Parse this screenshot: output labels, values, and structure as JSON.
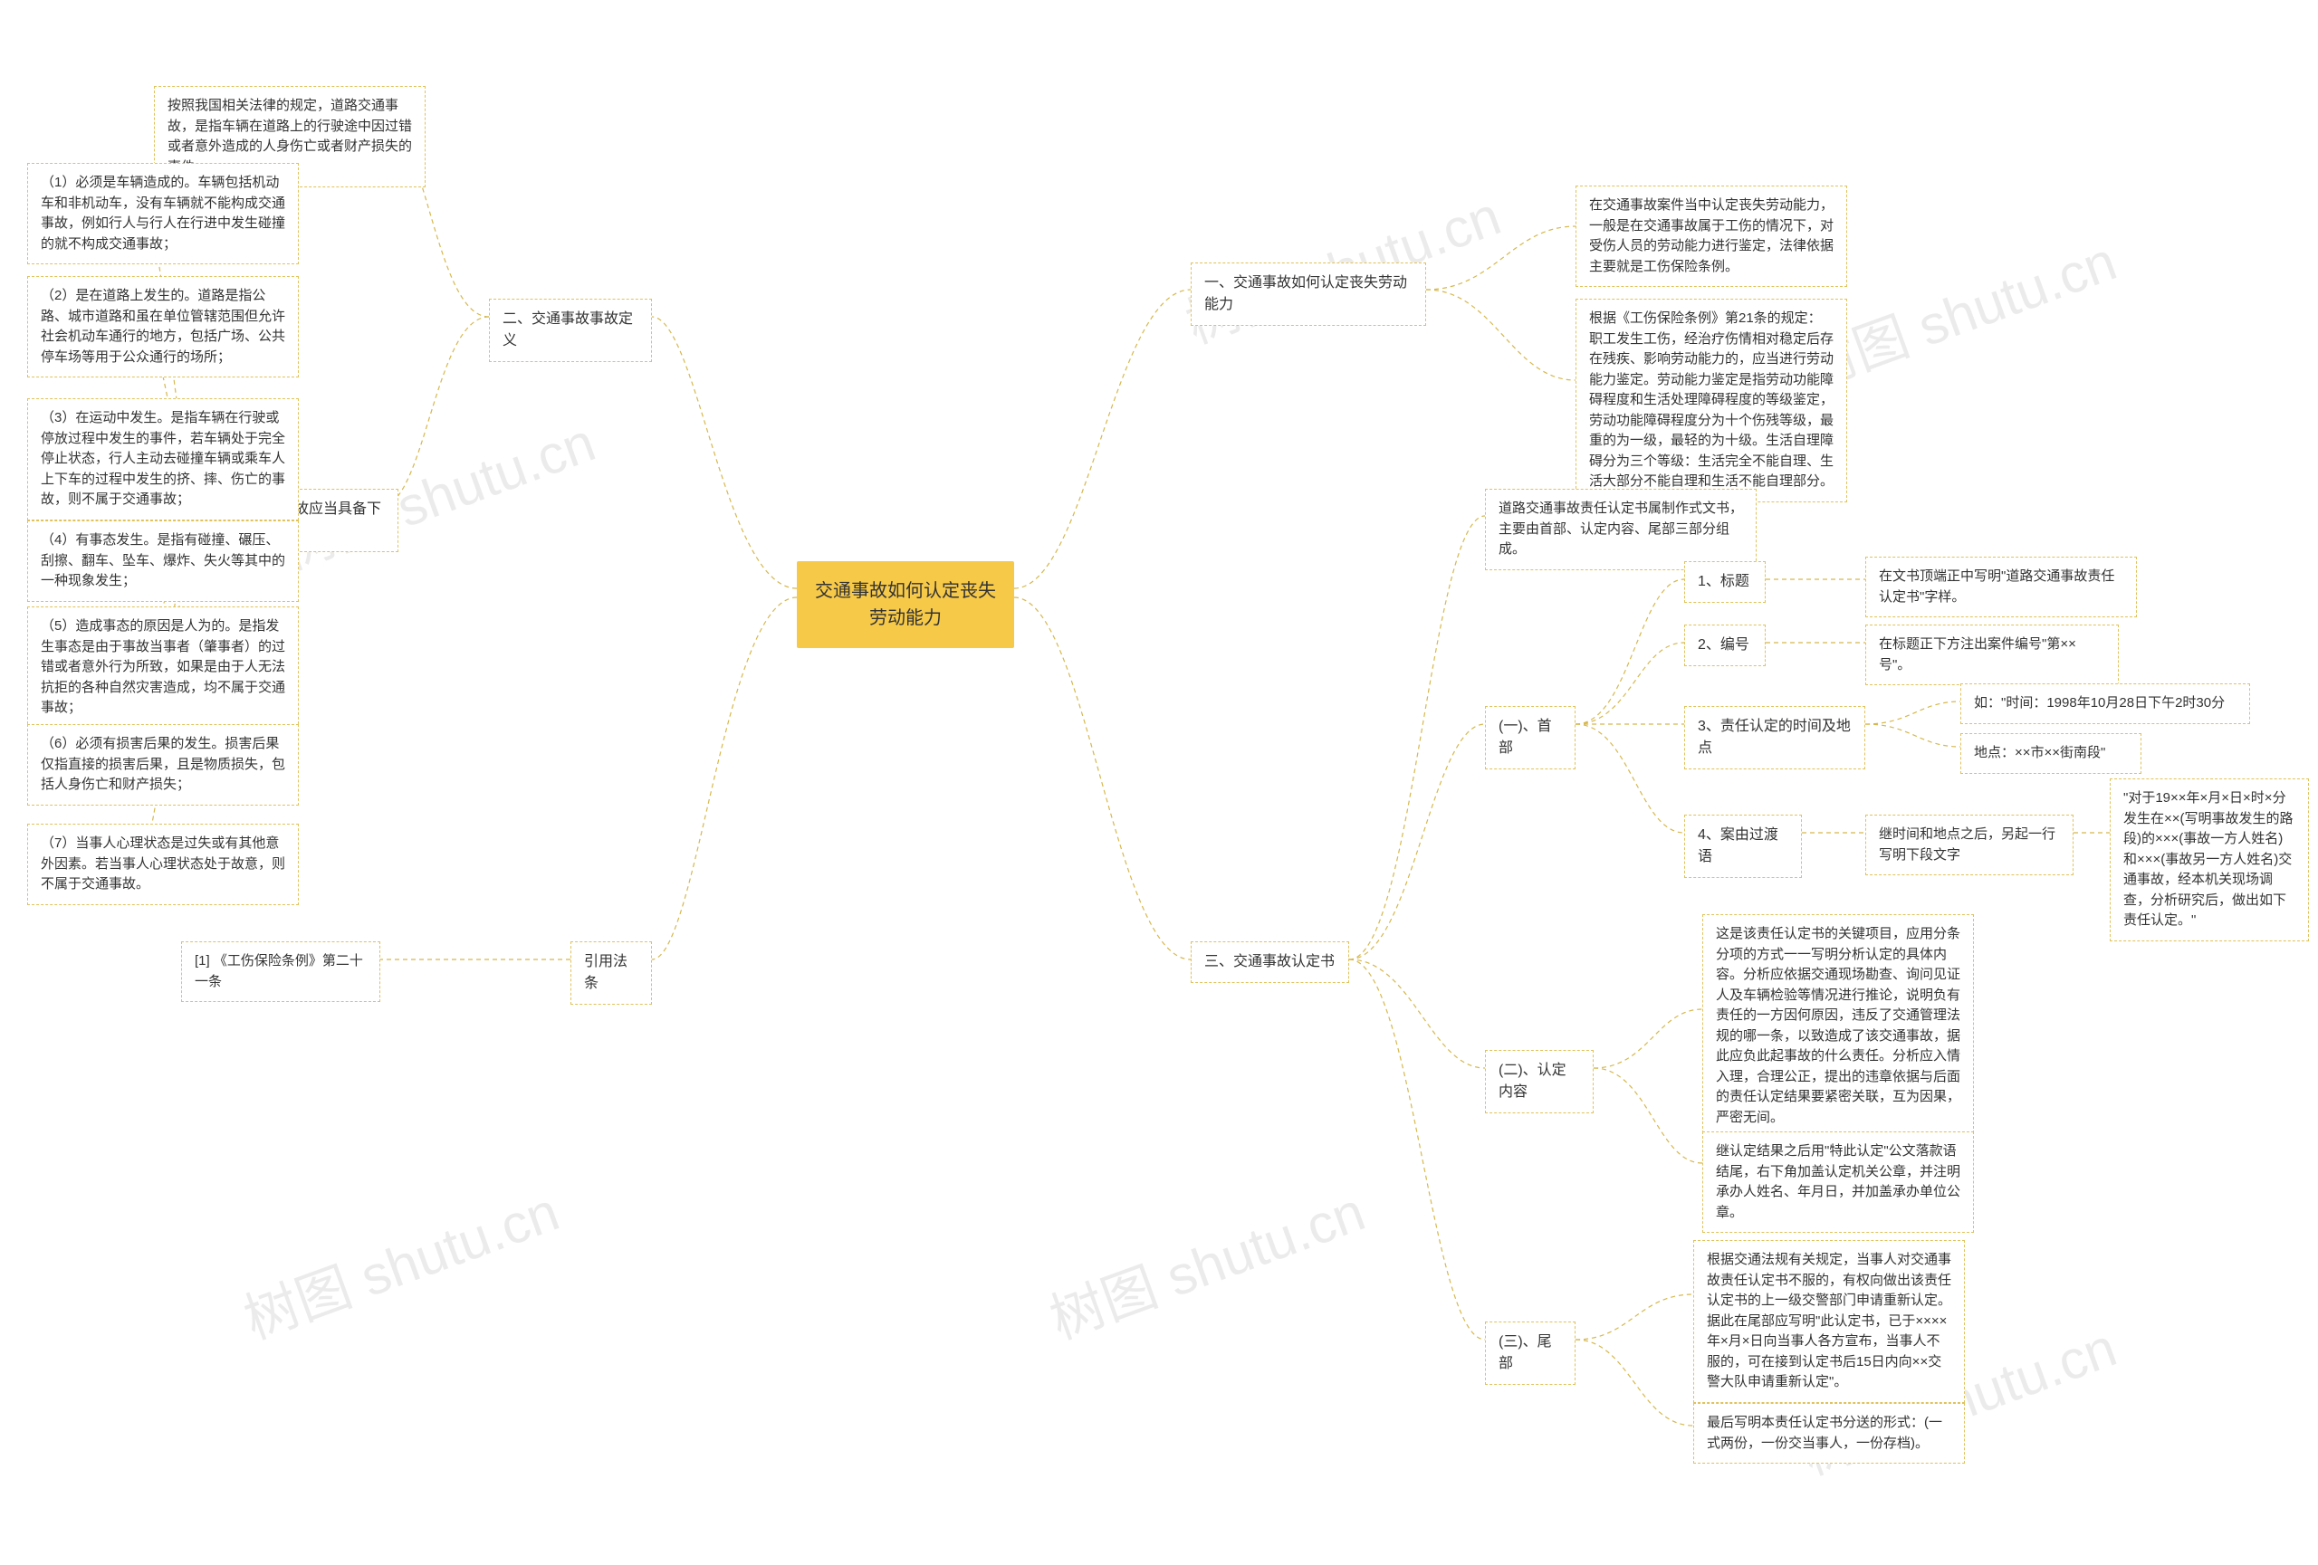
{
  "root": "交通事故如何认定丧失劳动能力",
  "watermark": "树图 shutu.cn",
  "left": {
    "branch2": {
      "title": "二、交通事故事故定义",
      "intro": "按照我国相关法律的规定，道路交通事故，是指车辆在道路上的行驶途中因过错或者意外造成的人身伤亡或者财产损失的事件。",
      "sub": "构成交通事故应当具备下列要素：",
      "items": {
        "i1": "（1）必须是车辆造成的。车辆包括机动车和非机动车，没有车辆就不能构成交通事故，例如行人与行人在行进中发生碰撞的就不构成交通事故；",
        "i2": "（2）是在道路上发生的。道路是指公路、城市道路和虽在单位管辖范围但允许社会机动车通行的地方，包括广场、公共停车场等用于公众通行的场所；",
        "i3": "（3）在运动中发生。是指车辆在行驶或停放过程中发生的事件，若车辆处于完全停止状态，行人主动去碰撞车辆或乘车人上下车的过程中发生的挤、摔、伤亡的事故，则不属于交通事故；",
        "i4": "（4）有事态发生。是指有碰撞、碾压、刮擦、翻车、坠车、爆炸、失火等其中的一种现象发生；",
        "i5": "（5）造成事态的原因是人为的。是指发生事态是由于事故当事者（肇事者）的过错或者意外行为所致，如果是由于人无法抗拒的各种自然灾害造成，均不属于交通事故；",
        "i6": "（6）必须有损害后果的发生。损害后果仅指直接的损害后果，且是物质损失，包括人身伤亡和财产损失；",
        "i7": "（7）当事人心理状态是过失或有其他意外因素。若当事人心理状态处于故意，则不属于交通事故。"
      }
    },
    "branch_law": {
      "title": "引用法条",
      "item": "[1] 《工伤保险条例》第二十一条"
    }
  },
  "right": {
    "branch1": {
      "title": "一、交通事故如何认定丧失劳动能力",
      "items": {
        "i1": "在交通事故案件当中认定丧失劳动能力，一般是在交通事故属于工伤的情况下，对受伤人员的劳动能力进行鉴定，法律依据主要就是工伤保险条例。",
        "i2": "根据《工伤保险条例》第21条的规定：职工发生工伤，经治疗伤情相对稳定后存在残疾、影响劳动能力的，应当进行劳动能力鉴定。劳动能力鉴定是指劳动功能障碍程度和生活处理障碍程度的等级鉴定，劳动功能障碍程度分为十个伤残等级，最重的为一级，最轻的为十级。生活自理障碍分为三个等级：生活完全不能自理、生活大部分不能自理和生活不能自理部分。"
      }
    },
    "branch3": {
      "title": "三、交通事故认定书",
      "intro": "道路交通事故责任认定书属制作式文书，主要由首部、认定内容、尾部三部分组成。",
      "s1": {
        "title": "(一)、首部",
        "n1": {
          "label": "1、标题",
          "text": "在文书顶端正中写明\"道路交通事故责任认定书\"字样。"
        },
        "n2": {
          "label": "2、编号",
          "text": "在标题正下方注出案件编号\"第××号\"。"
        },
        "n3": {
          "label": "3、责任认定的时间及地点",
          "t1": "如：\"时间：1998年10月28日下午2时30分",
          "t2": "地点：××市××街南段\""
        },
        "n4": {
          "label": "4、案由过渡语",
          "mid": "继时间和地点之后，另起一行写明下段文字",
          "text": "\"对于19××年×月×日×时×分发生在××(写明事故发生的路段)的×××(事故一方人姓名)和×××(事故另一方人姓名)交通事故，经本机关现场调查，分析研究后，做出如下责任认定。\""
        }
      },
      "s2": {
        "title": "(二)、认定内容",
        "t1": "这是该责任认定书的关键项目，应用分条分项的方式一一写明分析认定的具体内容。分析应依据交通现场勘查、询问见证人及车辆检验等情况进行推论，说明负有责任的一方因何原因，违反了交通管理法规的哪一条，以致造成了该交通事故，据此应负此起事故的什么责任。分析应入情入理，合理公正，提出的违章依据与后面的责任认定结果要紧密关联，互为因果，严密无间。",
        "t2": "继认定结果之后用\"特此认定\"公文落款语结尾，右下角加盖认定机关公章，并注明承办人姓名、年月日，并加盖承办单位公章。"
      },
      "s3": {
        "title": "(三)、尾部",
        "t1": "根据交通法规有关规定，当事人对交通事故责任认定书不服的，有权向做出该责任认定书的上一级交警部门申请重新认定。据此在尾部应写明\"此认定书，已于××××年×月×日向当事人各方宣布，当事人不服的，可在接到认定书后15日内向××交警大队申请重新认定\"。",
        "t2": "最后写明本责任认定书分送的形式：(一式两份，一份交当事人，一份存档)。"
      }
    }
  }
}
